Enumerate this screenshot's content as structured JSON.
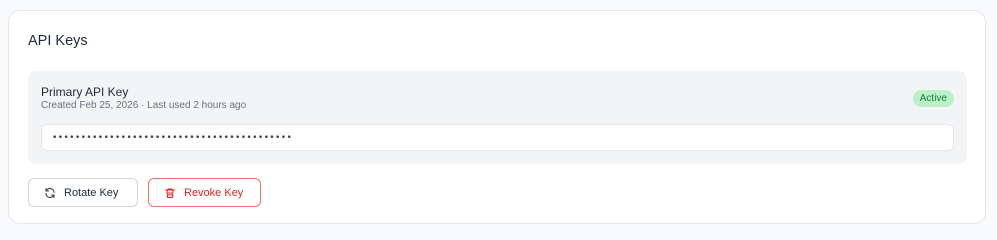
{
  "card": {
    "title": "API Keys"
  },
  "api_key": {
    "name": "Primary API Key",
    "meta": "Created Feb 25, 2026 · Last used 2 hours ago",
    "status": "Active",
    "masked_value": "••••••••••••••••••••••••••••••••••••••••••"
  },
  "actions": {
    "rotate_label": "Rotate Key",
    "revoke_label": "Revoke Key"
  },
  "icons": {
    "rotate": "refresh-icon",
    "revoke": "trash-icon"
  },
  "colors": {
    "status_bg": "#bbf0c8",
    "status_text": "#15803d",
    "danger": "#dc2626",
    "danger_border": "#f87171"
  }
}
